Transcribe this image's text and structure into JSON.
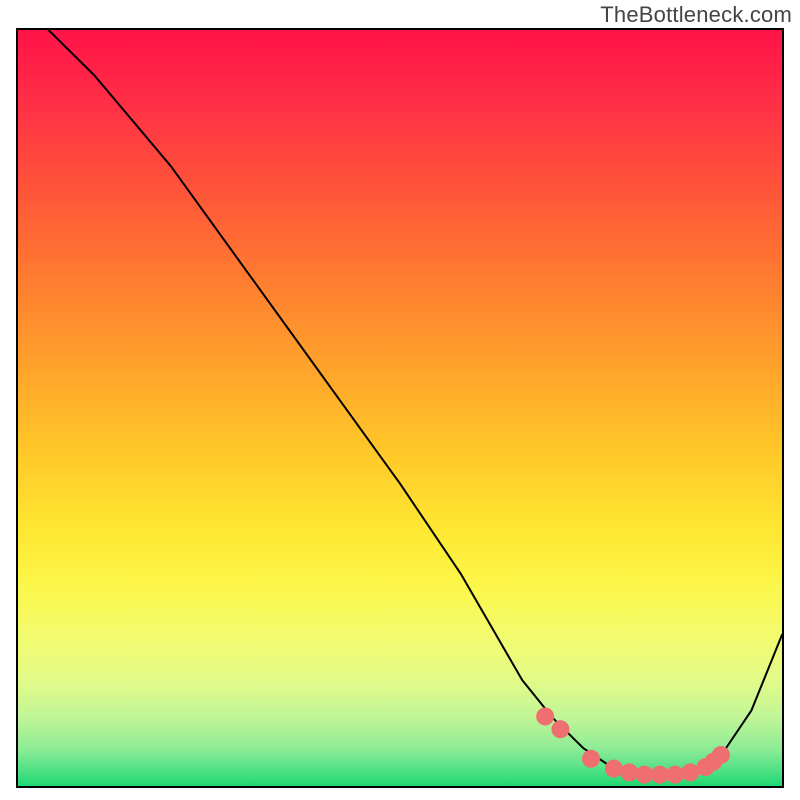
{
  "watermark": "TheBottleneck.com",
  "chart_data": {
    "type": "line",
    "title": "",
    "xlabel": "",
    "ylabel": "",
    "xlim": [
      0,
      100
    ],
    "ylim": [
      0,
      100
    ],
    "grid": false,
    "legend": null,
    "series": [
      {
        "name": "curve",
        "x": [
          4,
          10,
          20,
          30,
          40,
          50,
          58,
          62,
          66,
          70,
          74,
          78,
          82,
          86,
          90,
          92,
          96,
          100
        ],
        "y": [
          100,
          94,
          82,
          68,
          54,
          40,
          28,
          21,
          14,
          9,
          5,
          2.3,
          1.5,
          1.5,
          2.4,
          4,
          10,
          20
        ],
        "stroke": "#000000",
        "stroke_width": 2
      },
      {
        "name": "markers",
        "x": [
          69,
          71,
          75,
          78,
          80,
          82,
          84,
          86,
          88,
          90,
          91,
          92
        ],
        "y": [
          9.2,
          7.5,
          3.6,
          2.3,
          1.8,
          1.5,
          1.5,
          1.5,
          1.8,
          2.5,
          3.2,
          4.1
        ],
        "marker": "circle",
        "marker_color": "#ef6e70",
        "marker_radius": 9
      }
    ],
    "background_gradient_stops": [
      {
        "pos": 0.0,
        "color": "#ff1348"
      },
      {
        "pos": 0.08,
        "color": "#ff2a47"
      },
      {
        "pos": 0.18,
        "color": "#ff4a3c"
      },
      {
        "pos": 0.3,
        "color": "#ff7232"
      },
      {
        "pos": 0.42,
        "color": "#ff9a2c"
      },
      {
        "pos": 0.55,
        "color": "#ffc528"
      },
      {
        "pos": 0.66,
        "color": "#ffe732"
      },
      {
        "pos": 0.74,
        "color": "#fbf74b"
      },
      {
        "pos": 0.8,
        "color": "#f3fb6e"
      },
      {
        "pos": 0.86,
        "color": "#e2fb88"
      },
      {
        "pos": 0.91,
        "color": "#c0f597"
      },
      {
        "pos": 0.95,
        "color": "#8eec96"
      },
      {
        "pos": 0.98,
        "color": "#4fe184"
      },
      {
        "pos": 1.0,
        "color": "#1fd874"
      }
    ]
  }
}
